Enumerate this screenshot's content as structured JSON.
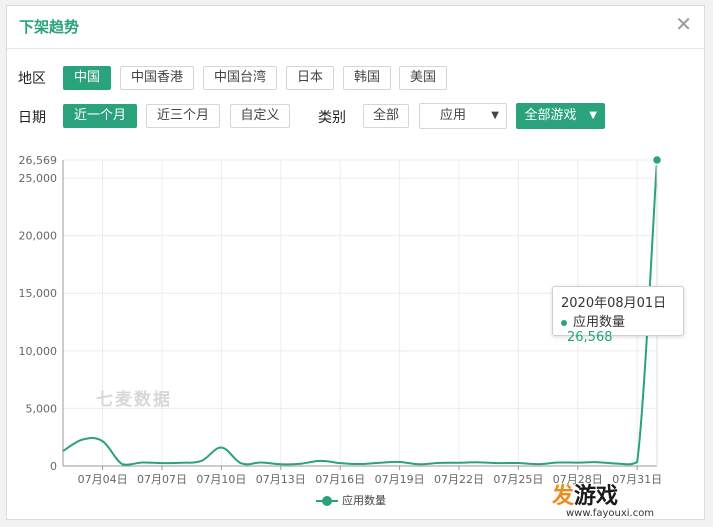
{
  "header": {
    "title": "下架趋势"
  },
  "filters": {
    "region_label": "地区",
    "regions": [
      "中国",
      "中国香港",
      "中国台湾",
      "日本",
      "韩国",
      "美国"
    ],
    "date_label": "日期",
    "dates": [
      "近一个月",
      "近三个月",
      "自定义"
    ],
    "category_label": "类别",
    "category_all": "全部",
    "category_select": "应用",
    "game_select": "全部游戏"
  },
  "icons": {
    "close": "close-icon",
    "caret": "chevron-down-icon"
  },
  "colors": {
    "accent": "#2aa37c"
  },
  "watermark": "七麦数据",
  "tooltip": {
    "date": "2020年08月01日",
    "series": "应用数量",
    "value": "26,568"
  },
  "brand": {
    "name_first": "发",
    "name_rest": "游戏",
    "url": "www.fayouxi.com"
  },
  "chart_data": {
    "type": "line",
    "x": [
      "07月02日",
      "07月03日",
      "07月04日",
      "07月05日",
      "07月06日",
      "07月07日",
      "07月08日",
      "07月09日",
      "07月10日",
      "07月11日",
      "07月12日",
      "07月13日",
      "07月14日",
      "07月15日",
      "07月16日",
      "07月17日",
      "07月18日",
      "07月19日",
      "07月20日",
      "07月21日",
      "07月22日",
      "07月23日",
      "07月24日",
      "07月25日",
      "07月26日",
      "07月27日",
      "07月28日",
      "07月29日",
      "07月30日",
      "07月31日",
      "08月01日"
    ],
    "x_tick_labels": [
      "07月04日",
      "07月07日",
      "07月10日",
      "07月13日",
      "07月16日",
      "07月19日",
      "07月22日",
      "07月25日",
      "07月28日",
      "07月31日"
    ],
    "series": [
      {
        "name": "应用数量",
        "values": [
          1300,
          2300,
          2150,
          150,
          300,
          250,
          280,
          450,
          1600,
          230,
          300,
          150,
          200,
          450,
          250,
          170,
          280,
          350,
          150,
          270,
          280,
          320,
          250,
          260,
          160,
          300,
          290,
          330,
          210,
          350,
          26568
        ]
      }
    ],
    "y_ticks": [
      "0",
      "5,000",
      "10,000",
      "15,000",
      "20,000",
      "25,000",
      "26,569"
    ],
    "ylim": [
      0,
      26569
    ],
    "grid": true,
    "legend": "bottom-center"
  }
}
